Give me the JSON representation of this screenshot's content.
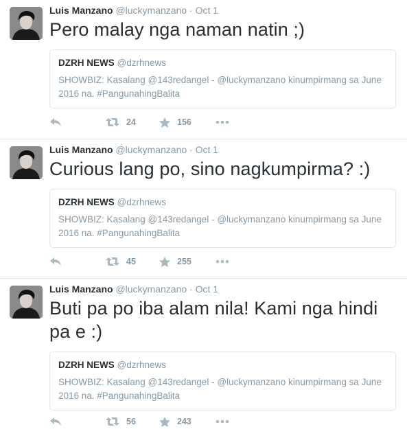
{
  "tweets": [
    {
      "author": {
        "name": "Luis Manzano",
        "handle": "@luckymanzano"
      },
      "sep": "·",
      "time": "Oct 1",
      "text": "Pero malay nga naman natin ;)",
      "quote": {
        "name": "DZRH NEWS",
        "handle": "@dzrhnews",
        "text": "SHOWBIZ: Kasalang @143redangel - @luckymanzano kinumpirmang sa June 2016 na. #PangunahingBalita"
      },
      "retweets": "24",
      "favorites": "156"
    },
    {
      "author": {
        "name": "Luis Manzano",
        "handle": "@luckymanzano"
      },
      "sep": "·",
      "time": "Oct 1",
      "text": "Curious lang po, sino nagkumpirma? :)",
      "quote": {
        "name": "DZRH NEWS",
        "handle": "@dzrhnews",
        "text": "SHOWBIZ: Kasalang @143redangel - @luckymanzano kinumpirmang sa June 2016 na. #PangunahingBalita"
      },
      "retweets": "45",
      "favorites": "255"
    },
    {
      "author": {
        "name": "Luis Manzano",
        "handle": "@luckymanzano"
      },
      "sep": "·",
      "time": "Oct 1",
      "text": "Buti pa po iba alam nila! Kami nga hindi pa e :)",
      "quote": {
        "name": "DZRH NEWS",
        "handle": "@dzrhnews",
        "text": "SHOWBIZ: Kasalang @143redangel - @luckymanzano kinumpirmang sa June 2016 na. #PangunahingBalita"
      },
      "retweets": "56",
      "favorites": "243"
    }
  ],
  "colors": {
    "text": "#292f33",
    "muted": "#8899a6",
    "border": "#e1e8ed"
  },
  "icons": {
    "reply": "reply-icon",
    "retweet": "retweet-icon",
    "favorite": "star-icon",
    "more": "more-icon"
  }
}
